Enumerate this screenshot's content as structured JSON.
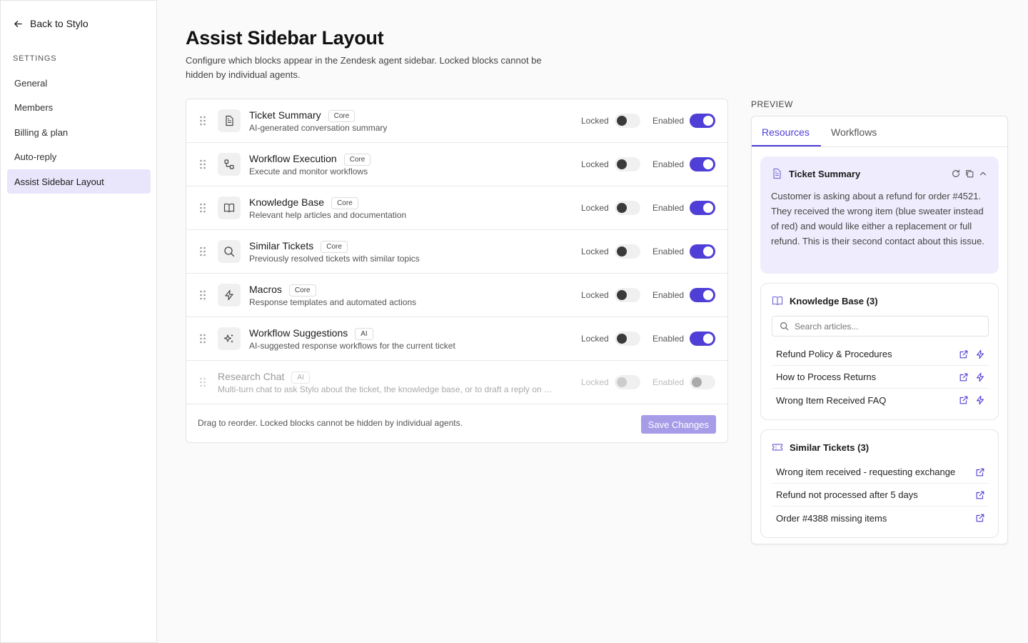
{
  "sidebar": {
    "back_label": "Back to Stylo",
    "section_label": "SETTINGS",
    "items": [
      {
        "label": "General",
        "active": false
      },
      {
        "label": "Members",
        "active": false
      },
      {
        "label": "Billing & plan",
        "active": false
      },
      {
        "label": "Auto-reply",
        "active": false
      },
      {
        "label": "Assist Sidebar Layout",
        "active": true
      }
    ]
  },
  "page": {
    "title": "Assist Sidebar Layout",
    "subtitle": "Configure which blocks appear in the Zendesk agent sidebar. Locked blocks cannot be hidden by individual agents."
  },
  "blocks": [
    {
      "name": "Ticket Summary",
      "badge": "Core",
      "desc": "AI-generated conversation summary",
      "icon": "document-icon",
      "locked": false,
      "enabled": true,
      "locked_label": "Locked",
      "enabled_label": "Enabled"
    },
    {
      "name": "Workflow Execution",
      "badge": "Core",
      "desc": "Execute and monitor workflows",
      "icon": "workflow-icon",
      "locked": false,
      "enabled": true,
      "locked_label": "Locked",
      "enabled_label": "Enabled"
    },
    {
      "name": "Knowledge Base",
      "badge": "Core",
      "desc": "Relevant help articles and documentation",
      "icon": "book-icon",
      "locked": false,
      "enabled": true,
      "locked_label": "Locked",
      "enabled_label": "Enabled"
    },
    {
      "name": "Similar Tickets",
      "badge": "Core",
      "desc": "Previously resolved tickets with similar topics",
      "icon": "search-icon",
      "locked": false,
      "enabled": true,
      "locked_label": "Locked",
      "enabled_label": "Enabled"
    },
    {
      "name": "Macros",
      "badge": "Core",
      "desc": "Response templates and automated actions",
      "icon": "lightning-icon",
      "locked": false,
      "enabled": true,
      "locked_label": "Locked",
      "enabled_label": "Enabled"
    },
    {
      "name": "Workflow Suggestions",
      "badge": "AI",
      "desc": "AI-suggested response workflows for the current ticket",
      "icon": "sparkles-icon",
      "locked": false,
      "enabled": true,
      "locked_label": "Locked",
      "enabled_label": "Enabled"
    },
    {
      "name": "Research Chat",
      "badge": "AI",
      "desc": "Multi-turn chat to ask Stylo about the ticket, the knowledge base, or to draft a reply on …",
      "icon": "",
      "locked": false,
      "enabled": false,
      "disabled": true,
      "locked_label": "Locked",
      "enabled_label": "Enabled"
    }
  ],
  "footer": {
    "hint": "Drag to reorder. Locked blocks cannot be hidden by individual agents.",
    "save_label": "Save Changes"
  },
  "preview": {
    "label": "PREVIEW",
    "tabs": [
      {
        "label": "Resources",
        "active": true
      },
      {
        "label": "Workflows",
        "active": false
      }
    ],
    "summary": {
      "title": "Ticket Summary",
      "text": "Customer is asking about a refund for order #4521. They received the wrong item (blue sweater instead of red) and would like either a replacement or full refund. This is their second contact about this issue."
    },
    "knowledge_base": {
      "title": "Knowledge Base (3)",
      "search_placeholder": "Search articles...",
      "articles": [
        "Refund Policy & Procedures",
        "How to Process Returns",
        "Wrong Item Received FAQ"
      ]
    },
    "similar_tickets": {
      "title": "Similar Tickets (3)",
      "tickets": [
        "Wrong item received - requesting exchange",
        "Refund not processed after 5 days",
        "Order #4388 missing items"
      ]
    }
  },
  "colors": {
    "accent": "#4f3fd6",
    "accent_light": "#efedfd",
    "nav_active": "#e9e6fb",
    "save_disabled": "#a69ce8"
  }
}
